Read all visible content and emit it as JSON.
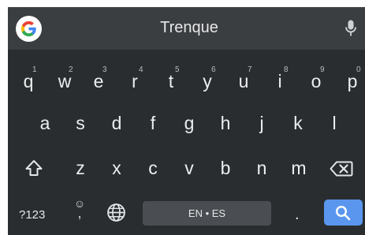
{
  "suggestion_strip": {
    "word": "Trenque"
  },
  "rows": {
    "row1": [
      {
        "letter": "q",
        "hint": "1"
      },
      {
        "letter": "w",
        "hint": "2"
      },
      {
        "letter": "e",
        "hint": "3"
      },
      {
        "letter": "r",
        "hint": "4"
      },
      {
        "letter": "t",
        "hint": "5"
      },
      {
        "letter": "y",
        "hint": "6"
      },
      {
        "letter": "u",
        "hint": "7"
      },
      {
        "letter": "i",
        "hint": "8"
      },
      {
        "letter": "o",
        "hint": "9"
      },
      {
        "letter": "p",
        "hint": "0"
      }
    ],
    "row2": [
      "a",
      "s",
      "d",
      "f",
      "g",
      "h",
      "j",
      "k",
      "l"
    ],
    "row3": [
      "z",
      "x",
      "c",
      "v",
      "b",
      "n",
      "m"
    ]
  },
  "bottom": {
    "symbols_label": "?123",
    "emoji_glyph": "☺",
    "comma_glyph": ",",
    "space_label": "EN • ES",
    "period_label": "."
  },
  "icons": [
    "google-g-icon",
    "microphone-icon",
    "shift-icon",
    "backspace-icon",
    "globe-icon",
    "search-icon"
  ],
  "colors": {
    "keyboard_bg": "#2a2d30",
    "strip_bg": "#3b3e41",
    "key_text": "#eceeef",
    "space_bg": "#4a4d51",
    "action_key": "#5a96ee"
  }
}
